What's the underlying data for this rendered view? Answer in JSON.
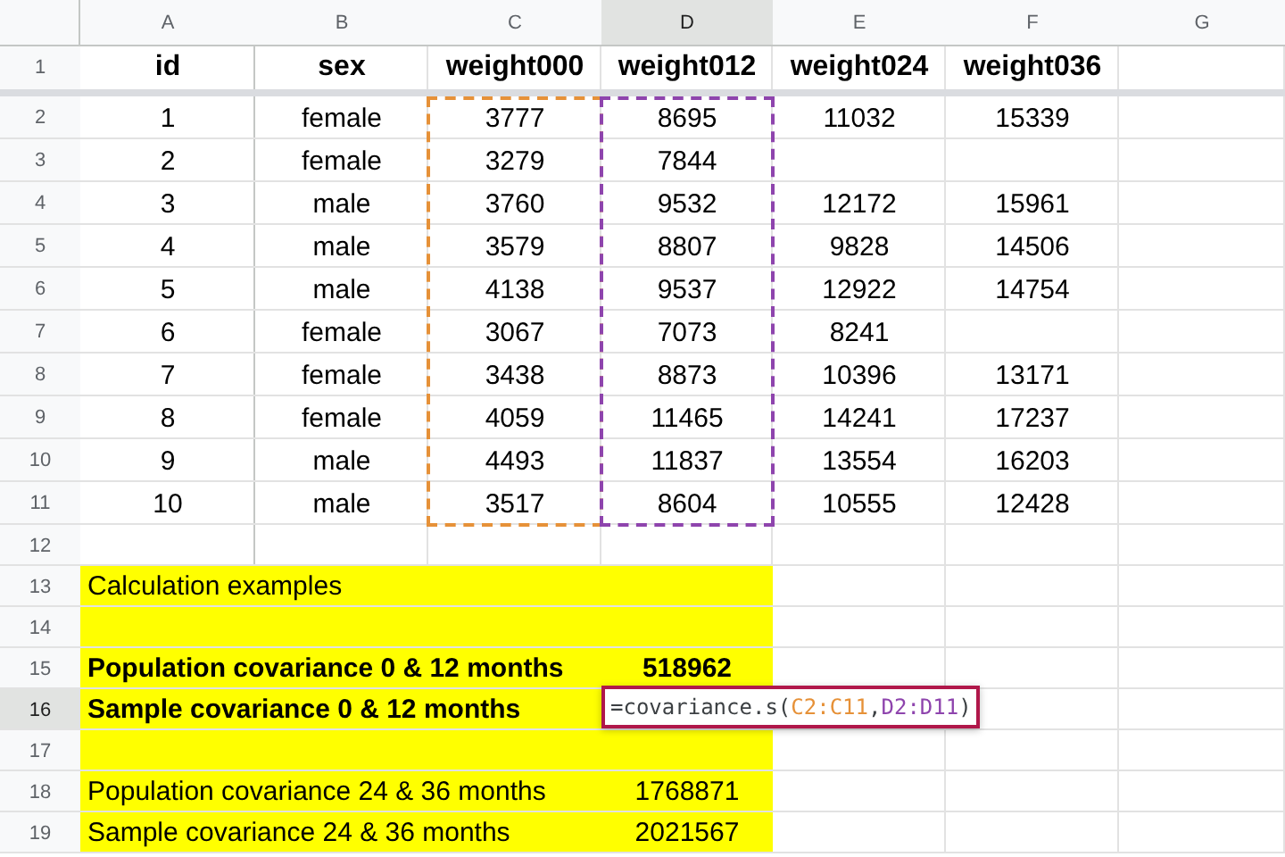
{
  "columns": [
    {
      "label": "A",
      "selected": false
    },
    {
      "label": "B",
      "selected": false
    },
    {
      "label": "C",
      "selected": false,
      "color": "#e69138"
    },
    {
      "label": "D",
      "selected": true,
      "color": "#8e44ad"
    },
    {
      "label": "E",
      "selected": false
    },
    {
      "label": "F",
      "selected": false
    },
    {
      "label": "G",
      "selected": false
    }
  ],
  "rows": [
    {
      "number": "1",
      "selected": false,
      "bold": true,
      "cells": [
        "id",
        "sex",
        "weight000",
        "weight012",
        "weight024",
        "weight036"
      ]
    },
    {
      "number": "2",
      "selected": false,
      "in_range": true,
      "cells": [
        "1",
        "female",
        "3777",
        "8695",
        "11032",
        "15339"
      ]
    },
    {
      "number": "3",
      "selected": false,
      "in_range": true,
      "cells": [
        "2",
        "female",
        "3279",
        "7844"
      ]
    },
    {
      "number": "4",
      "selected": false,
      "in_range": true,
      "cells": [
        "3",
        "male",
        "3760",
        "9532",
        "12172",
        "15961"
      ]
    },
    {
      "number": "5",
      "selected": false,
      "in_range": true,
      "cells": [
        "4",
        "male",
        "3579",
        "8807",
        "9828",
        "14506"
      ]
    },
    {
      "number": "6",
      "selected": false,
      "in_range": true,
      "cells": [
        "5",
        "male",
        "4138",
        "9537",
        "12922",
        "14754"
      ]
    },
    {
      "number": "7",
      "selected": false,
      "in_range": true,
      "cells": [
        "6",
        "female",
        "3067",
        "7073",
        "8241"
      ]
    },
    {
      "number": "8",
      "selected": false,
      "in_range": true,
      "cells": [
        "7",
        "female",
        "3438",
        "8873",
        "10396",
        "13171"
      ]
    },
    {
      "number": "9",
      "selected": false,
      "in_range": true,
      "cells": [
        "8",
        "female",
        "4059",
        "11465",
        "14241",
        "17237"
      ]
    },
    {
      "number": "10",
      "selected": false,
      "in_range": true,
      "cells": [
        "9",
        "male",
        "4493",
        "11837",
        "13554",
        "16203"
      ]
    },
    {
      "number": "11",
      "selected": false,
      "in_range": true,
      "cells": [
        "10",
        "male",
        "3517",
        "8604",
        "10555",
        "12428"
      ]
    },
    {
      "number": "12",
      "selected": false,
      "cells": []
    },
    {
      "number": "13",
      "selected": false,
      "highlighted": true,
      "cells": [
        "Calculation examples"
      ]
    },
    {
      "number": "14",
      "selected": false,
      "highlighted": true,
      "cells": []
    },
    {
      "number": "15",
      "selected": false,
      "highlighted": true,
      "bold": true,
      "cells": [
        "Population covariance 0 & 12 months",
        null,
        null,
        "518962"
      ]
    },
    {
      "number": "16",
      "selected": true,
      "highlighted": true,
      "bold": true,
      "cells": [
        "Sample covariance 0 & 12 months",
        null,
        null,
        {
          "kind": "formula",
          "parts": [
            {
              "text": "=covariance.s("
            },
            {
              "text": "C2:C11",
              "color": "#e69138"
            },
            {
              "text": ","
            },
            {
              "text": "D2:D11",
              "color": "#8e44ad"
            },
            {
              "text": ")"
            }
          ]
        }
      ]
    },
    {
      "number": "17",
      "selected": false,
      "highlighted": true,
      "cells": []
    },
    {
      "number": "18",
      "selected": false,
      "highlighted": true,
      "cells": [
        "Population covariance 24 & 36 months",
        null,
        null,
        "1768871"
      ]
    },
    {
      "number": "19",
      "selected": false,
      "highlighted": true,
      "cells": [
        "Sample covariance 24 & 36 months",
        null,
        null,
        "2021567"
      ]
    }
  ]
}
